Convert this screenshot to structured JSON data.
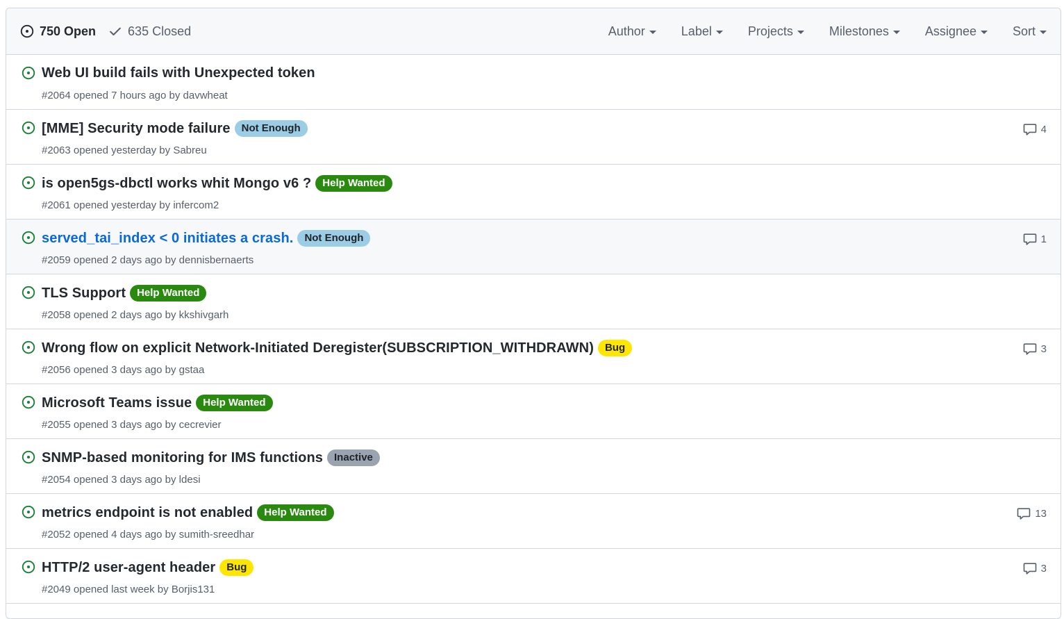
{
  "header": {
    "open_label": "750 Open",
    "closed_label": "635 Closed",
    "filters": [
      "Author",
      "Label",
      "Projects",
      "Milestones",
      "Assignee",
      "Sort"
    ]
  },
  "colors": {
    "open_icon": "#1a7f37",
    "link_hover": "#0969da",
    "not_enough": "#9ccde6",
    "help_wanted": "#2a8a0f",
    "bug": "#ffe600",
    "inactive": "#9aa3b0"
  },
  "issues": [
    {
      "title": "Web UI build fails with Unexpected token",
      "label": "",
      "label_bg": "",
      "label_fg": "",
      "meta": "#2064 opened 7 hours ago by ",
      "author": "davwheat",
      "comments": ""
    },
    {
      "title": "[MME] Security mode failure",
      "label": "Not Enough",
      "label_bg": "#9ccde6",
      "label_fg": "#1f2328",
      "meta": "#2063 opened yesterday by ",
      "author": "Sabreu",
      "comments": "4"
    },
    {
      "title": "is open5gs-dbctl works whit Mongo v6 ?",
      "label": "Help Wanted",
      "label_bg": "#2a8a0f",
      "label_fg": "#ffffff",
      "meta": "#2061 opened yesterday by ",
      "author": "infercom2",
      "comments": ""
    },
    {
      "title": "served_tai_index < 0 initiates a crash.",
      "label": "Not Enough",
      "label_bg": "#9ccde6",
      "label_fg": "#1f2328",
      "meta": "#2059 opened 2 days ago by ",
      "author": "dennisbernaerts",
      "comments": "1"
    },
    {
      "title": "TLS Support",
      "label": "Help Wanted",
      "label_bg": "#2a8a0f",
      "label_fg": "#ffffff",
      "meta": "#2058 opened 2 days ago by ",
      "author": "kkshivgarh",
      "comments": ""
    },
    {
      "title": "Wrong flow on explicit Network-Initiated Deregister(SUBSCRIPTION_WITHDRAWN)",
      "label": "Bug",
      "label_bg": "#ffe600",
      "label_fg": "#1f2328",
      "meta": "#2056 opened 3 days ago by ",
      "author": "gstaa",
      "comments": "3"
    },
    {
      "title": "Microsoft Teams issue",
      "label": "Help Wanted",
      "label_bg": "#2a8a0f",
      "label_fg": "#ffffff",
      "meta": "#2055 opened 3 days ago by ",
      "author": "cecrevier",
      "comments": ""
    },
    {
      "title": "SNMP-based monitoring for IMS functions",
      "label": "Inactive",
      "label_bg": "#9aa3b0",
      "label_fg": "#1f2328",
      "meta": "#2054 opened 3 days ago by ",
      "author": "ldesi",
      "comments": ""
    },
    {
      "title": "metrics endpoint is not enabled",
      "label": "Help Wanted",
      "label_bg": "#2a8a0f",
      "label_fg": "#ffffff",
      "meta": "#2052 opened 4 days ago by ",
      "author": "sumith-sreedhar",
      "comments": "13"
    },
    {
      "title": "HTTP/2 user-agent header",
      "label": "Bug",
      "label_bg": "#ffe600",
      "label_fg": "#1f2328",
      "meta": "#2049 opened last week by ",
      "author": "Borjis131",
      "comments": "3"
    }
  ],
  "hover_row_index": 3
}
